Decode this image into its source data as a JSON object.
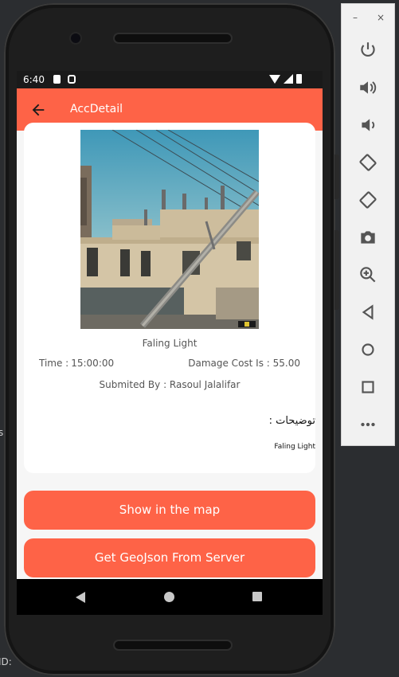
{
  "status_bar": {
    "time": "6:40"
  },
  "app_bar": {
    "title": "AccDetail"
  },
  "detail": {
    "photo_caption": "Faling Light",
    "time_label": "Time :",
    "time_value": "15:00:00",
    "damage_cost": "Damage Cost Is : 55.00",
    "submitted_by": "Submited By : Rasoul Jalalifar",
    "description_title": "توضیحات :",
    "description_body": "Faling Light"
  },
  "buttons": {
    "show_map": "Show in the map",
    "get_geojson": "Get GeoJson From Server"
  },
  "emulator": {
    "minimize": "–",
    "close": "×"
  },
  "background": {
    "fragment_1": "s",
    "fragment_2": "ID:"
  },
  "colors": {
    "accent": "#fe6347",
    "status_bar": "#1a1a1a",
    "nav_bar": "#000000"
  }
}
